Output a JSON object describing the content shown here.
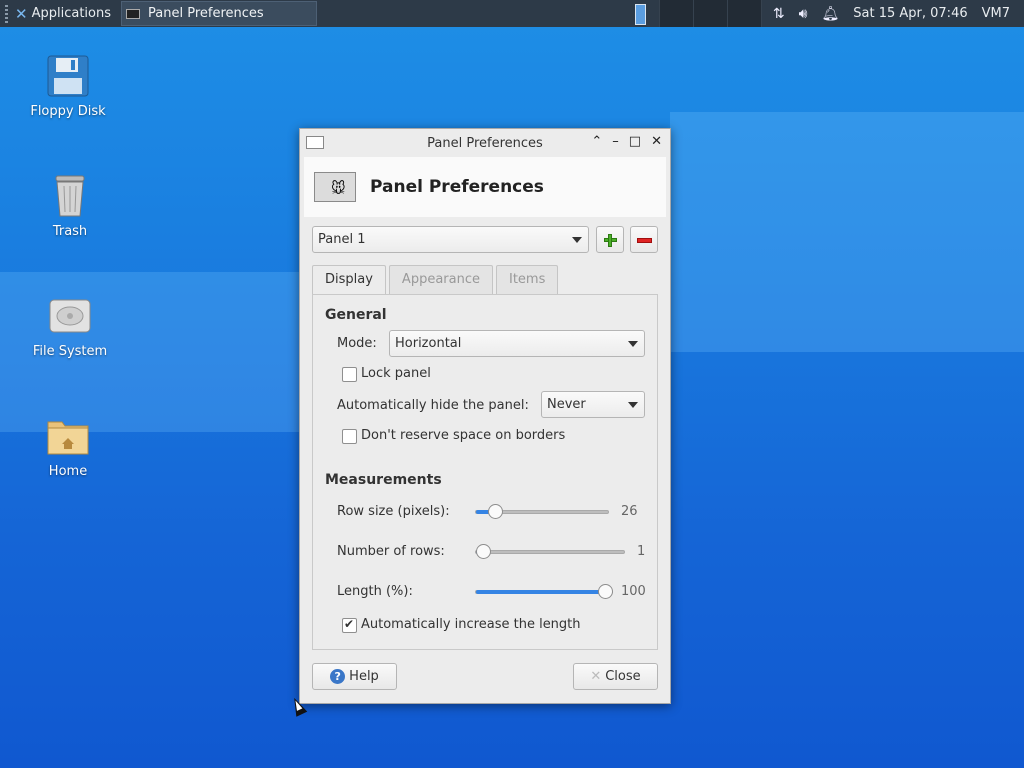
{
  "colors": {
    "panel_bg": "#2d3a48",
    "desktop": "#1a7fe0",
    "accent": "#3584e4",
    "add_green": "#4caf2a",
    "remove_red": "#e02424"
  },
  "top_panel": {
    "applications_label": "Applications",
    "task_title": "Panel Preferences",
    "clock": "Sat 15 Apr, 07:46",
    "user": "VM7",
    "tray_icons": [
      "network-icon",
      "volume-icon",
      "notification-bell-icon"
    ]
  },
  "desktop": {
    "icons": [
      {
        "label": "Floppy Disk",
        "icon": "floppy-disk-icon"
      },
      {
        "label": "Trash",
        "icon": "trash-icon"
      },
      {
        "label": "File System",
        "icon": "hard-drive-icon"
      },
      {
        "label": "Home",
        "icon": "home-folder-icon"
      }
    ]
  },
  "window": {
    "title": "Panel Preferences",
    "header_title": "Panel Preferences",
    "panel_select": "Panel 1",
    "tabs": [
      {
        "label": "Display",
        "active": true
      },
      {
        "label": "Appearance",
        "active": false
      },
      {
        "label": "Items",
        "active": false
      }
    ],
    "general": {
      "heading": "General",
      "mode_label": "Mode:",
      "mode_value": "Horizontal",
      "lock_panel_label": "Lock panel",
      "lock_panel_checked": false,
      "autohide_label": "Automatically hide the panel:",
      "autohide_value": "Never",
      "reserve_label": "Don't reserve space on borders",
      "reserve_checked": false
    },
    "measurements": {
      "heading": "Measurements",
      "row_size_label": "Row size (pixels):",
      "row_size_value": "26",
      "row_size_fraction": 0.1,
      "rows_label": "Number of rows:",
      "rows_value": "1",
      "rows_fraction": 0.0,
      "length_label": "Length (%):",
      "length_value": "100",
      "length_fraction": 1.0,
      "auto_length_label": "Automatically increase the length",
      "auto_length_checked": true
    },
    "buttons": {
      "help": "Help",
      "close": "Close"
    }
  }
}
